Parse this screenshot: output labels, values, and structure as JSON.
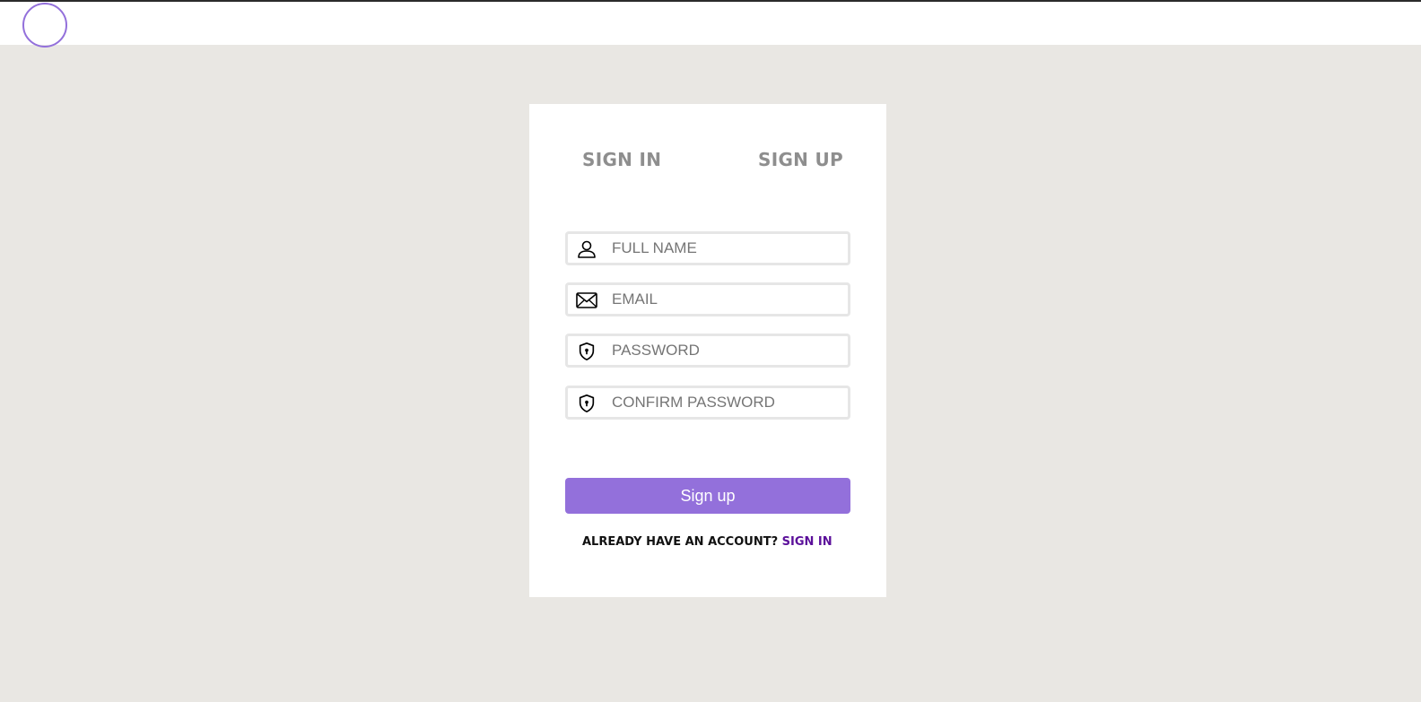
{
  "colors": {
    "accent": "#9370db",
    "background": "#e9e7e3",
    "link": "#5b0f9a"
  },
  "tabs": {
    "signin_label": "SIGN IN",
    "signup_label": "SIGN UP"
  },
  "form": {
    "full_name": {
      "placeholder": "FULL NAME",
      "value": "",
      "icon": "user-icon"
    },
    "email": {
      "placeholder": "EMAIL",
      "value": "",
      "icon": "mail-icon"
    },
    "password": {
      "placeholder": "PASSWORD",
      "value": "",
      "icon": "shield-lock-icon"
    },
    "confirm_password": {
      "placeholder": "CONFIRM PASSWORD",
      "value": "",
      "icon": "shield-lock-icon"
    },
    "submit_label": "Sign up"
  },
  "footer": {
    "prompt": "ALREADY HAVE AN ACCOUNT?",
    "link_label": "SIGN IN"
  }
}
